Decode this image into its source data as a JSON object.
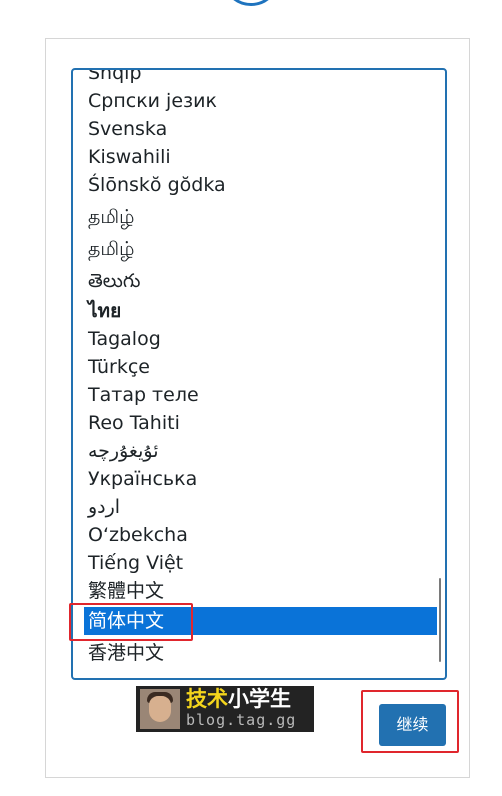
{
  "language_list": {
    "options": [
      "Shqip",
      "Српски језик",
      "Svenska",
      "Kiswahili",
      "Ślōnskŏ gŏdka",
      "தமிழ்",
      "தமிழ்",
      "తెలుగు",
      "ไทย",
      "Tagalog",
      "Türkçe",
      "Татар теле",
      "Reo Tahiti",
      "ئۇيغۇرچە",
      "Українська",
      "اردو",
      "O‘zbekcha",
      "Tiếng Việt",
      "繁體中文",
      "简体中文",
      "香港中文"
    ],
    "selected": "简体中文"
  },
  "watermark": {
    "title_highlight": "技术",
    "title_rest": "小学生",
    "subtitle": "blog.tag.gg"
  },
  "buttons": {
    "continue_label": "继续"
  },
  "colors": {
    "accent": "#2271b1",
    "selected_bg": "#0a73d8",
    "annotation_red": "#e0262d"
  }
}
